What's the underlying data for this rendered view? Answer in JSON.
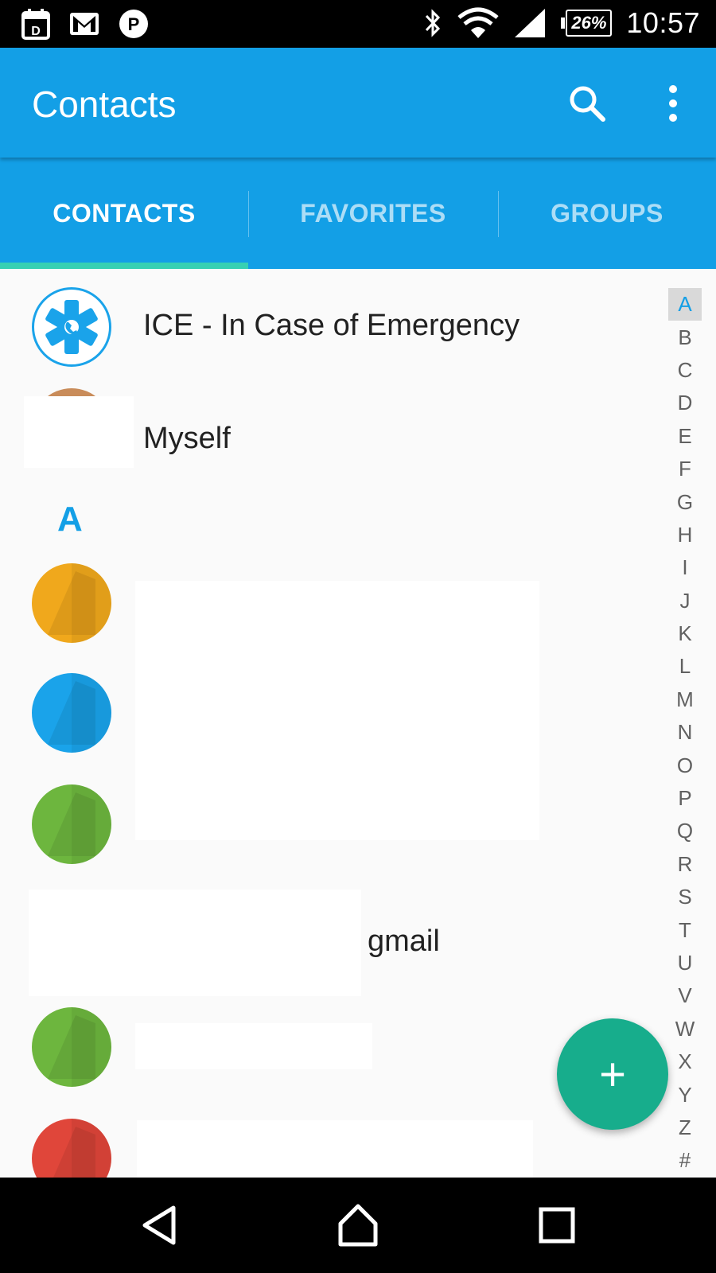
{
  "status_bar": {
    "time": "10:57",
    "battery": "26%",
    "icons": [
      "calendar-icon",
      "gmail-icon",
      "parking-icon",
      "bluetooth-icon",
      "wifi-icon",
      "signal-icon"
    ]
  },
  "app_bar": {
    "title": "Contacts",
    "actions": [
      "search-icon",
      "more-vert-icon"
    ]
  },
  "tabs": [
    {
      "label": "CONTACTS",
      "selected": true
    },
    {
      "label": "FAVORITES",
      "selected": false
    },
    {
      "label": "GROUPS",
      "selected": false
    }
  ],
  "contacts": [
    {
      "name": "ICE - In Case of Emergency",
      "avatar": "ice-star-of-life-icon"
    },
    {
      "name": "Myself",
      "avatar": "photo"
    },
    {
      "section": "A"
    },
    {
      "name": "",
      "avatar": "placeholder",
      "color": "#f0a81c"
    },
    {
      "name": "",
      "avatar": "placeholder",
      "color": "#1aa3ea"
    },
    {
      "name": "",
      "avatar": "placeholder",
      "color": "#6db63e"
    },
    {
      "name": "gmail",
      "avatar": "hidden"
    },
    {
      "name": "",
      "avatar": "placeholder",
      "color": "#6db63e"
    },
    {
      "name": "",
      "avatar": "placeholder",
      "color": "#e0463a"
    }
  ],
  "index_letters": [
    "A",
    "B",
    "C",
    "D",
    "E",
    "F",
    "G",
    "H",
    "I",
    "J",
    "K",
    "L",
    "M",
    "N",
    "O",
    "P",
    "Q",
    "R",
    "S",
    "T",
    "U",
    "V",
    "W",
    "X",
    "Y",
    "Z",
    "#"
  ],
  "index_active": "A",
  "fab": {
    "label": "+"
  },
  "colors": {
    "primary": "#139fe6",
    "accent": "#37d0b3",
    "fab": "#17ad8c"
  }
}
